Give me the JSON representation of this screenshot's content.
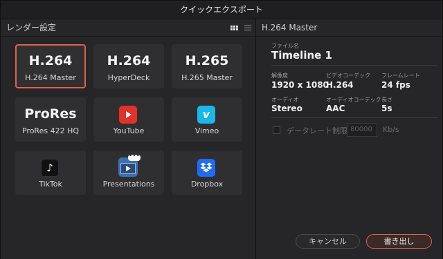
{
  "window": {
    "title": "クイックエクスポート"
  },
  "left_panel": {
    "title": "レンダー設定",
    "presets": [
      {
        "big": "H.264",
        "label": "H.264 Master",
        "selected": true
      },
      {
        "big": "H.264",
        "label": "HyperDeck"
      },
      {
        "big": "H.265",
        "label": "H.265 Master"
      },
      {
        "big": "ProRes",
        "label": "ProRes 422 HQ"
      },
      {
        "icon": "youtube-icon",
        "label": "YouTube"
      },
      {
        "icon": "vimeo-icon",
        "label": "Vimeo",
        "glyph": "v"
      },
      {
        "icon": "tiktok-icon",
        "label": "TikTok",
        "glyph": "♪"
      },
      {
        "icon": "presentations-icon",
        "label": "Presentations",
        "glyph": "•••"
      },
      {
        "icon": "dropbox-icon",
        "label": "Dropbox"
      }
    ]
  },
  "right_panel": {
    "title": "H.264 Master",
    "filename_label": "ファイル名",
    "filename": "Timeline 1",
    "resolution_label": "解像度",
    "resolution": "1920 x 1080",
    "video_codec_label": "ビデオコーデック",
    "video_codec": "H.264",
    "frame_rate_label": "フレームレート",
    "frame_rate": "24 fps",
    "audio_label": "オーディオ",
    "audio": "Stereo",
    "audio_codec_label": "オーディオコーデック",
    "audio_codec": "AAC",
    "length_label": "長さ",
    "length": "5s",
    "data_rate_label": "データレート制限：",
    "data_rate_value": "80000",
    "data_rate_unit": "Kb/s",
    "cancel_label": "キャンセル",
    "export_label": "書き出し"
  },
  "colors": {
    "accent": "#e0614a",
    "youtube": "#e2302b",
    "vimeo": "#1ab7ea",
    "dropbox": "#1e6bf5"
  }
}
